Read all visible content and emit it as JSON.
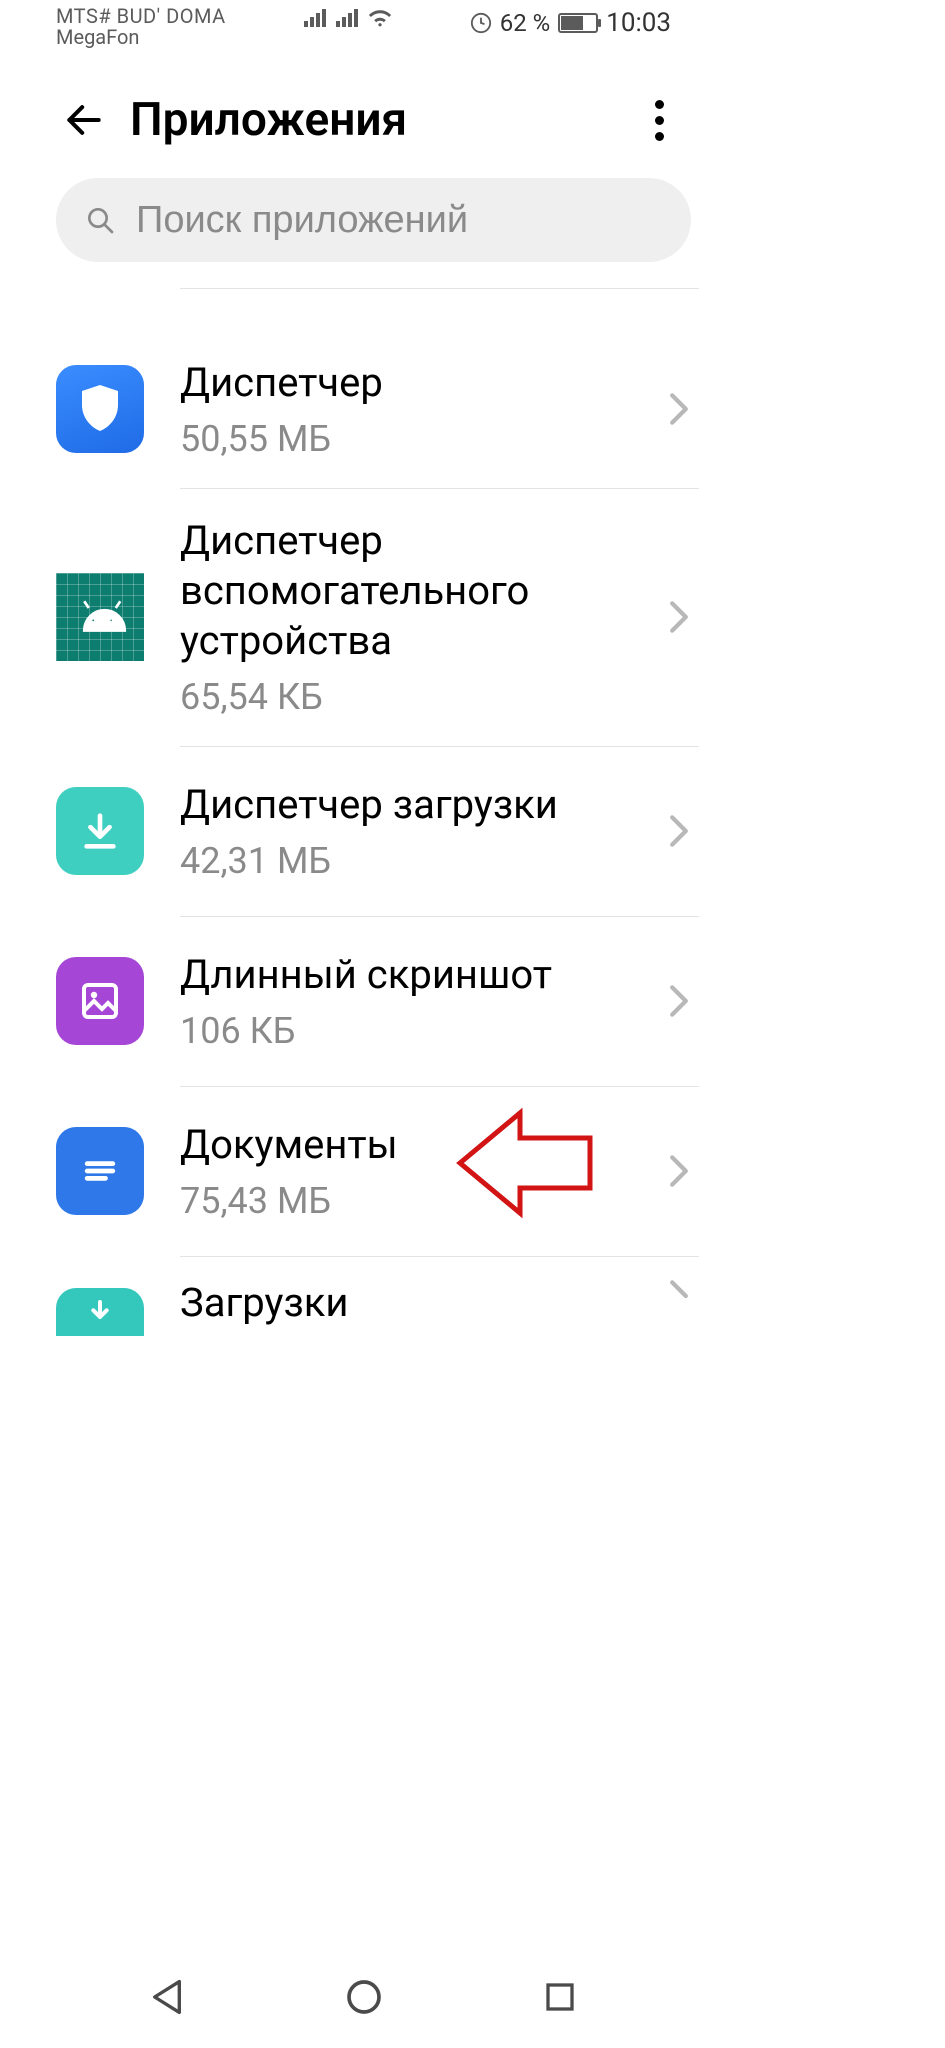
{
  "statusbar": {
    "carrier_line1": "MTS# BUD' DOMA",
    "carrier_line2": "MegaFon",
    "battery_pct": "62 %",
    "time": "10:03"
  },
  "header": {
    "title": "Приложения"
  },
  "search": {
    "placeholder": "Поиск приложений"
  },
  "apps": [
    {
      "name": "Диспетчер",
      "size": "50,55 МБ"
    },
    {
      "name": "Диспетчер вспомогательного устройства",
      "size": "65,54 КБ"
    },
    {
      "name": "Диспетчер загрузки",
      "size": "42,31 МБ"
    },
    {
      "name": "Длинный скриншот",
      "size": "106 КБ"
    },
    {
      "name": "Документы",
      "size": "75,43 МБ"
    },
    {
      "name": "Загрузки",
      "size": ""
    }
  ]
}
